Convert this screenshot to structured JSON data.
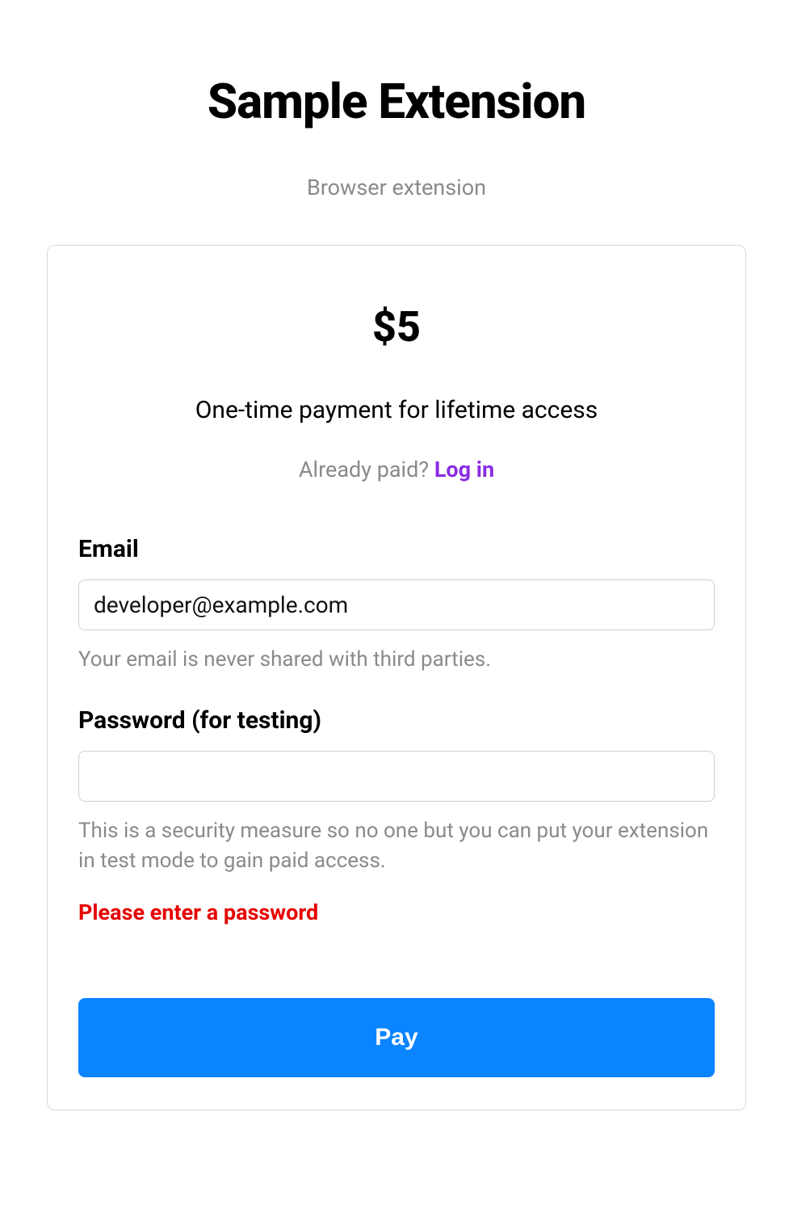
{
  "header": {
    "title": "Sample Extension",
    "subtitle": "Browser extension"
  },
  "card": {
    "price": "$5",
    "description": "One-time payment for lifetime access",
    "already_paid_text": "Already paid? ",
    "login_label": "Log in"
  },
  "form": {
    "email": {
      "label": "Email",
      "value": "developer@example.com",
      "help": "Your email is never shared with third parties."
    },
    "password": {
      "label": "Password (for testing)",
      "value": "",
      "help": "This is a security measure so no one but you can put your extension in test mode to gain paid access.",
      "error": "Please enter a password"
    },
    "submit_label": "Pay"
  }
}
